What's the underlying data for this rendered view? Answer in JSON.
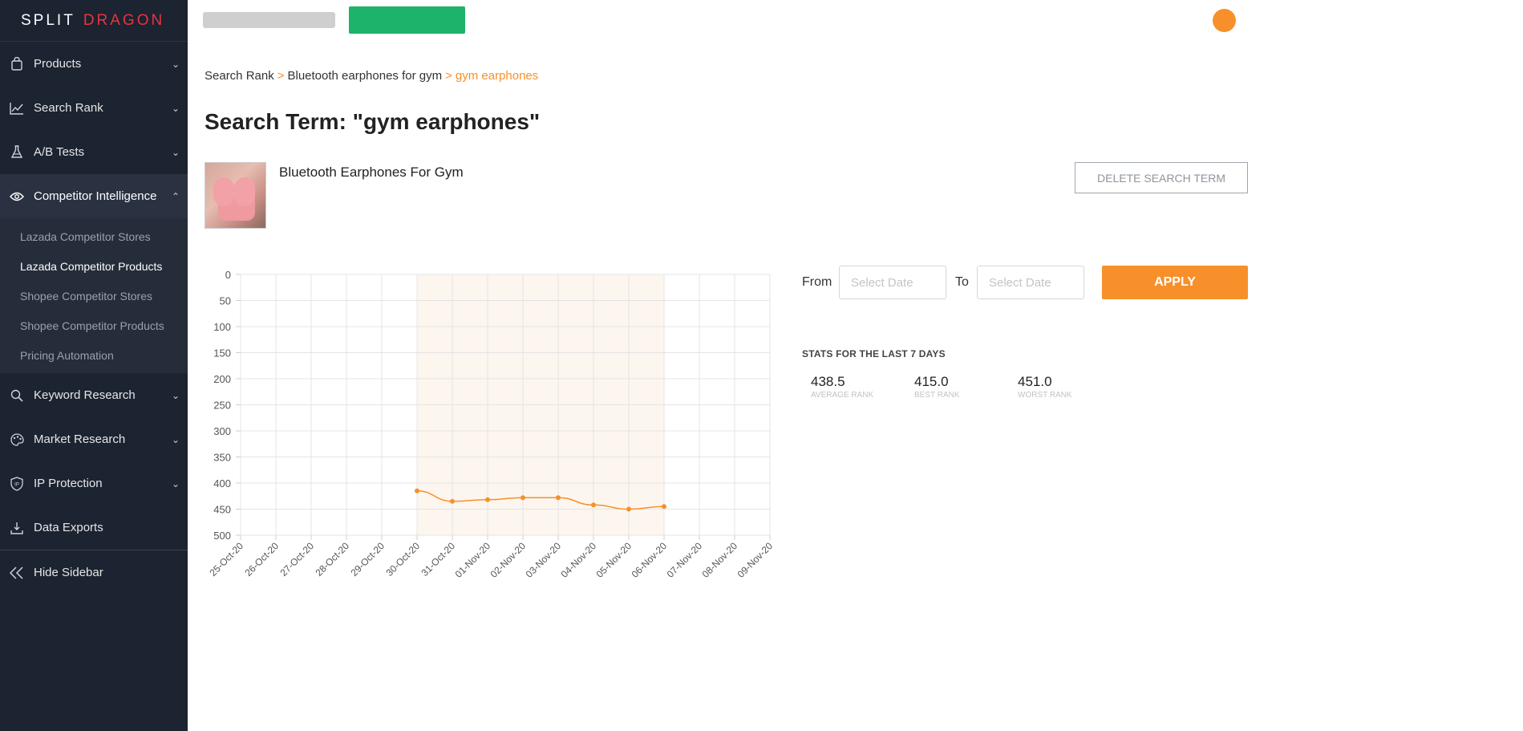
{
  "brand": {
    "word1": "SPLIT",
    "word2": "DRAGON"
  },
  "sidebar": {
    "items": [
      {
        "key": "products",
        "label": "Products",
        "icon": "shopping-bag-icon"
      },
      {
        "key": "search-rank",
        "label": "Search Rank",
        "icon": "trend-chart-icon"
      },
      {
        "key": "ab-tests",
        "label": "A/B Tests",
        "icon": "flask-icon"
      },
      {
        "key": "competitor-intelligence",
        "label": "Competitor Intelligence",
        "icon": "eye-icon"
      },
      {
        "key": "keyword-research",
        "label": "Keyword Research",
        "icon": "search-icon"
      },
      {
        "key": "market-research",
        "label": "Market Research",
        "icon": "palette-icon"
      },
      {
        "key": "ip-protection",
        "label": "IP Protection",
        "icon": "shield-ip-icon"
      },
      {
        "key": "data-exports",
        "label": "Data Exports",
        "icon": "download-tray-icon"
      }
    ],
    "competitor_sub": [
      "Lazada Competitor Stores",
      "Lazada Competitor Products",
      "Shopee Competitor Stores",
      "Shopee Competitor Products",
      "Pricing Automation"
    ],
    "hide_label": "Hide Sidebar"
  },
  "breadcrumb": {
    "items": [
      "Search Rank",
      "Bluetooth earphones for gym",
      "gym earphones"
    ],
    "separator": ">"
  },
  "page_title": "Search Term: \"gym earphones\"",
  "product": {
    "name": "Bluetooth Earphones For Gym"
  },
  "delete_label": "DELETE SEARCH TERM",
  "filters": {
    "from_label": "From",
    "to_label": "To",
    "from_placeholder": "Select Date",
    "to_placeholder": "Select Date",
    "apply_label": "APPLY"
  },
  "stats": {
    "title": "STATS FOR THE LAST 7 DAYS",
    "average": {
      "value": "438.5",
      "label": "AVERAGE RANK"
    },
    "best": {
      "value": "415.0",
      "label": "BEST RANK"
    },
    "worst": {
      "value": "451.0",
      "label": "WORST RANK"
    }
  },
  "colors": {
    "accent": "#f7902b",
    "green": "#1db36b",
    "sidebar_bg": "#1c2331",
    "brand_red": "#e8343f",
    "highlight_band": "#fdf6ef"
  },
  "chart_data": {
    "type": "line",
    "x": [
      "25-Oct-20",
      "26-Oct-20",
      "27-Oct-20",
      "28-Oct-20",
      "29-Oct-20",
      "30-Oct-20",
      "31-Oct-20",
      "01-Nov-20",
      "02-Nov-20",
      "03-Nov-20",
      "04-Nov-20",
      "05-Nov-20",
      "06-Nov-20",
      "07-Nov-20",
      "08-Nov-20",
      "09-Nov-20"
    ],
    "series": [
      {
        "values": [
          null,
          null,
          null,
          null,
          null,
          415,
          435,
          432,
          428,
          428,
          442,
          450,
          445,
          null,
          null,
          null
        ]
      }
    ],
    "highlight_range": [
      "30-Oct-20",
      "06-Nov-20"
    ],
    "ylim": [
      0,
      500
    ],
    "y_inverted": true,
    "yticks": [
      0,
      50,
      100,
      150,
      200,
      250,
      300,
      350,
      400,
      450,
      500
    ],
    "grid": true,
    "legend": "none"
  }
}
